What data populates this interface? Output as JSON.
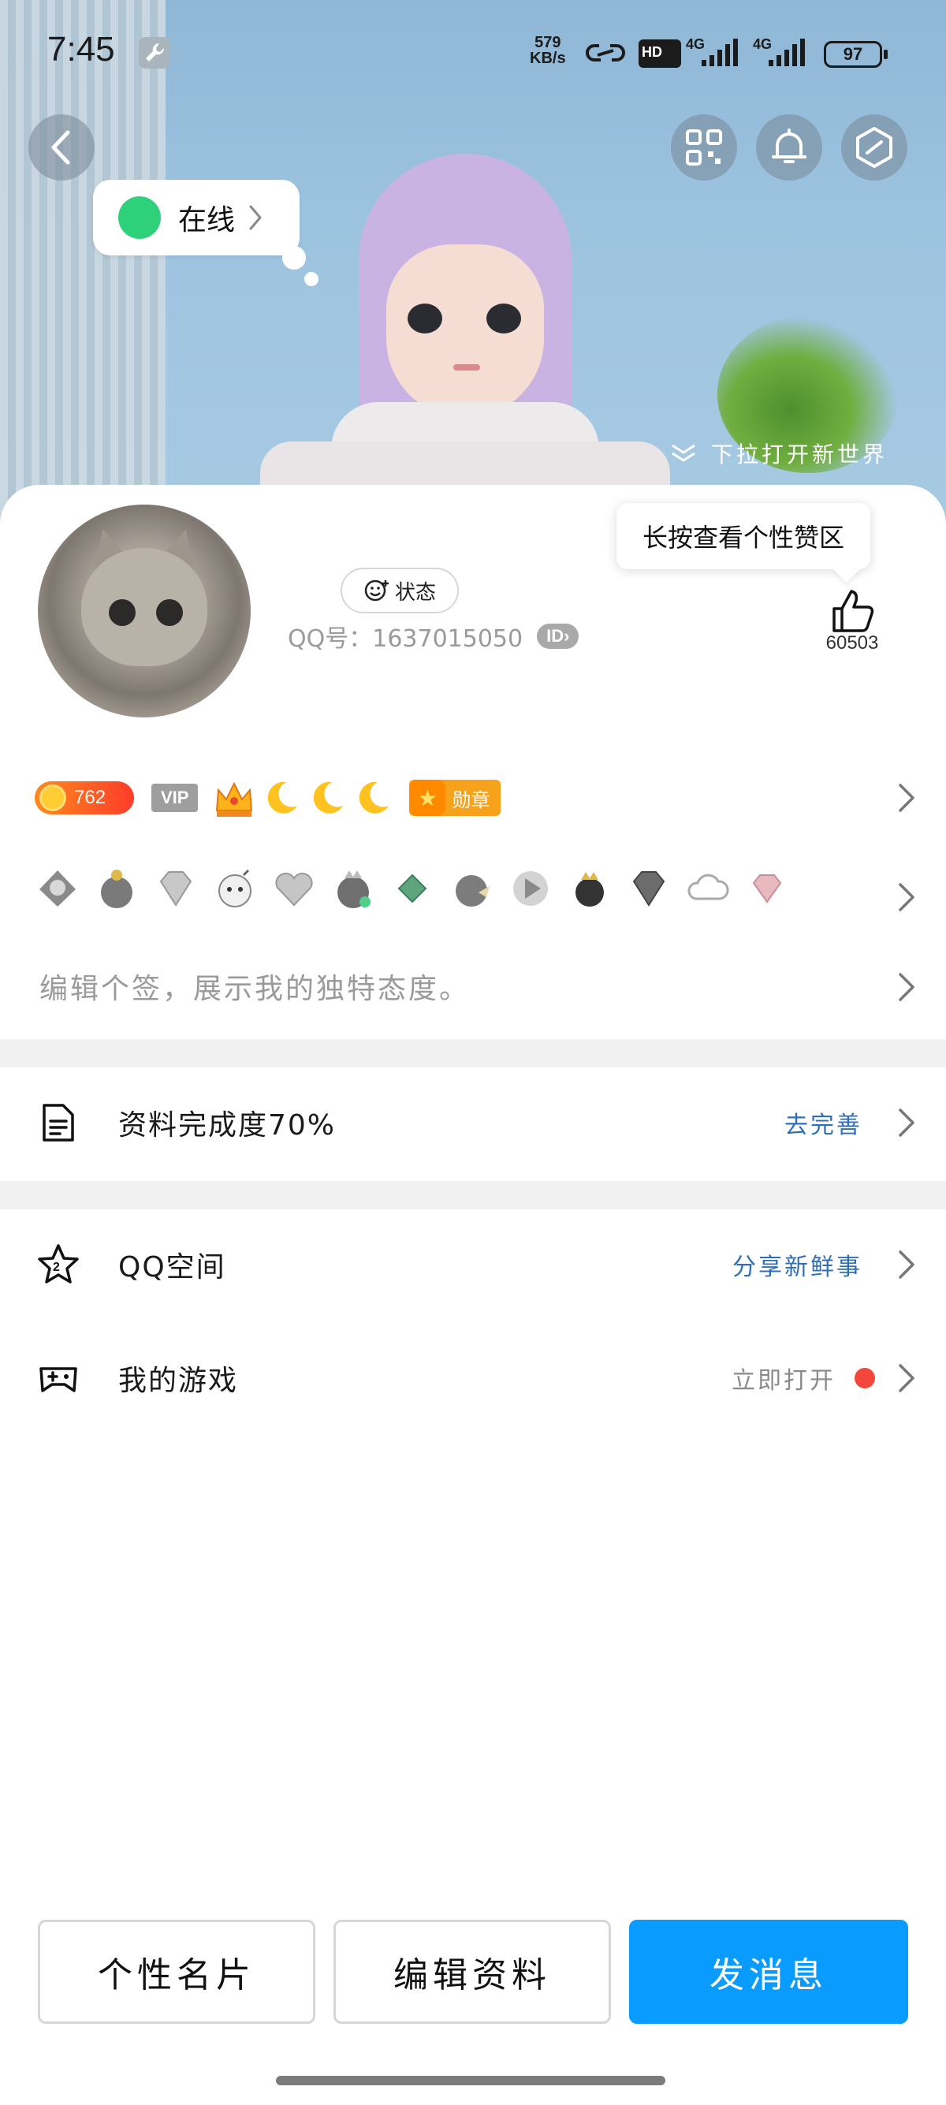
{
  "status_bar": {
    "time": "7:45",
    "net_speed_value": "579",
    "net_speed_unit": "KB/s",
    "network_type_1": "4G",
    "network_type_2": "4G",
    "hd_label": "HD",
    "battery": "97"
  },
  "hero": {
    "online_status": "在线",
    "pull_hint": "下拉打开新世界"
  },
  "profile": {
    "status_chip": "状态",
    "qq_number_text": "QQ号：1637015050",
    "id_badge": "ID",
    "like_tooltip": "长按查看个性赞区",
    "like_count": "60503"
  },
  "badges": {
    "coin_value": "762",
    "vip_label": "VIP",
    "medal_label": "勋章"
  },
  "signature_placeholder": "编辑个签，展示我的独特态度。",
  "menu": {
    "profile_completion": {
      "label": "资料完成度70%",
      "action": "去完善"
    },
    "qzone": {
      "label": "QQ空间",
      "action": "分享新鲜事"
    },
    "games": {
      "label": "我的游戏",
      "action": "立即打开"
    }
  },
  "bottom_buttons": {
    "card": "个性名片",
    "edit": "编辑资料",
    "message": "发消息"
  },
  "colors": {
    "primary_blue": "#0a9bff",
    "link_blue": "#2f6fb8",
    "online_green": "#2fd07a",
    "alert_red": "#f2473a"
  }
}
